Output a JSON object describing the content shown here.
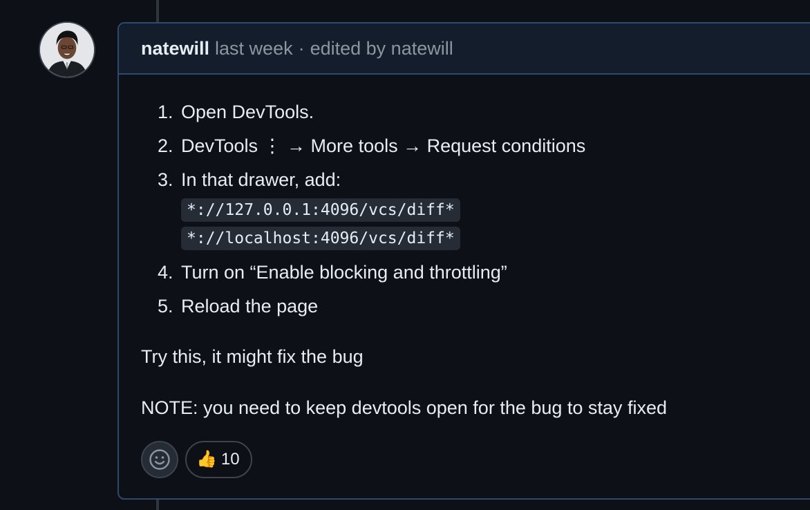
{
  "comment": {
    "author": "natewill",
    "time": "last week",
    "separator": "·",
    "edited": "edited by natewill",
    "steps": [
      {
        "num": "1.",
        "text": "Open DevTools."
      },
      {
        "num": "2.",
        "text": "DevTools ⋮ → More tools → Request conditions"
      },
      {
        "num": "3.",
        "text": "In that drawer, add:",
        "code": [
          "*://127.0.0.1:4096/vcs/diff*",
          "*://localhost:4096/vcs/diff*"
        ]
      },
      {
        "num": "4.",
        "text": "Turn on “Enable blocking and throttling”"
      },
      {
        "num": "5.",
        "text": "Reload the page"
      }
    ],
    "paragraphs": [
      "Try this, it might fix the bug",
      "NOTE: you need to keep devtools open for the bug to stay fixed"
    ]
  },
  "reactions": {
    "add_icon": "smiley-icon",
    "thumbs_up": {
      "emoji": "👍",
      "count": "10"
    }
  },
  "colors": {
    "background": "#0d1117",
    "header_background": "#141d2b",
    "border_accent": "#2e4a6f",
    "muted_text": "#8d96a0"
  }
}
